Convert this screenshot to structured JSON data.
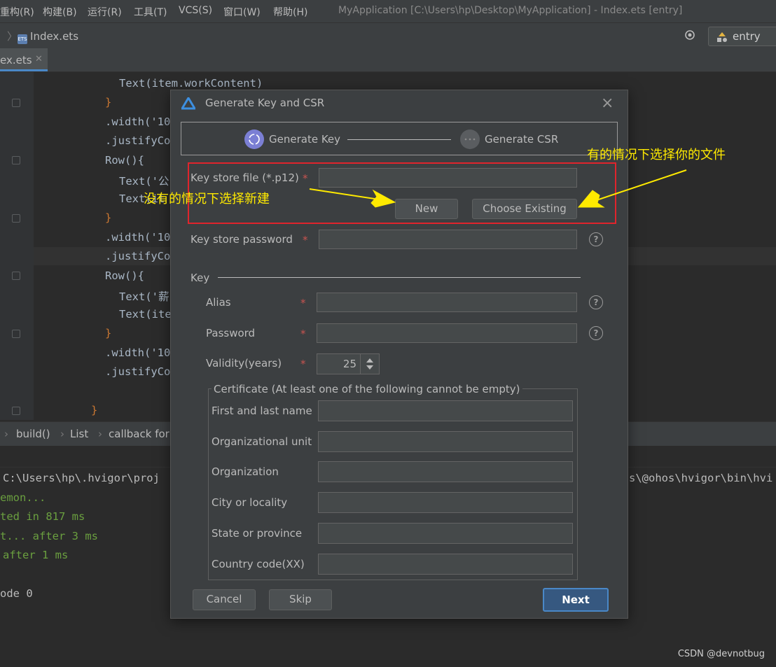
{
  "menubar": {
    "items": [
      "重构(R)",
      "构建(B)",
      "运行(R)",
      "工具(T)",
      "VCS(S)",
      "窗口(W)",
      "帮助(H)"
    ],
    "window_title": "MyApplication [C:\\Users\\hp\\Desktop\\MyApplication] - Index.ets [entry]"
  },
  "navbar": {
    "file": "Index.ets",
    "file_icon": "ETS",
    "run_config": "entry"
  },
  "tabs": {
    "active": "ex.ets"
  },
  "editor": {
    "lines": [
      "Text(item.workContent)",
      "}",
      ".width('10",
      ".justifyCo",
      "Row(){",
      "Text('公",
      "Text(it",
      "}",
      ".width('10",
      ".justifyCo",
      "Row(){",
      "Text('薪",
      "Text(ite",
      "}",
      ".width('10",
      ".justifyCo",
      "}"
    ]
  },
  "breadcrumbs": [
    "build()",
    "List",
    "callback for"
  ],
  "console": {
    "left": [
      "C:\\Users\\hp\\.hvigor\\proj",
      "emon...",
      "ted in 817 ms",
      "t... after 3 ms",
      "after 1 ms",
      "ode 0"
    ],
    "right": "s\\@ohos\\hvigor\\bin\\hvi"
  },
  "dialog": {
    "title": "Generate Key and CSR",
    "steps": {
      "step1": "Generate Key",
      "step2": "Generate CSR"
    },
    "keystore_file": {
      "label": "Key store file (*.p12)",
      "required": "*",
      "value": ""
    },
    "new_button": "New",
    "choose_existing_button": "Choose Existing",
    "keystore_password": {
      "label": "Key store password",
      "required": "*",
      "value": ""
    },
    "key_section": "Key",
    "alias": {
      "label": "Alias",
      "required": "*",
      "value": ""
    },
    "password": {
      "label": "Password",
      "required": "*",
      "value": ""
    },
    "validity": {
      "label": "Validity(years)",
      "required": "*",
      "value": "25"
    },
    "help_glyph": "?",
    "certificate": {
      "legend": "Certificate (At least one of the following cannot be empty)",
      "fields": [
        {
          "label": "First and last name",
          "value": ""
        },
        {
          "label": "Organizational unit",
          "value": ""
        },
        {
          "label": "Organization",
          "value": ""
        },
        {
          "label": "City or locality",
          "value": ""
        },
        {
          "label": "State or province",
          "value": ""
        },
        {
          "label": "Country code(XX)",
          "value": ""
        }
      ]
    },
    "cancel_button": "Cancel",
    "skip_button": "Skip",
    "next_button": "Next"
  },
  "annotations": {
    "left_note": "没有的情况下选择新建",
    "right_note": "有的情况下选择你的文件",
    "box_color": "#e0242c",
    "text_color": "#ffea00"
  },
  "watermark": "CSDN @devnotbug"
}
